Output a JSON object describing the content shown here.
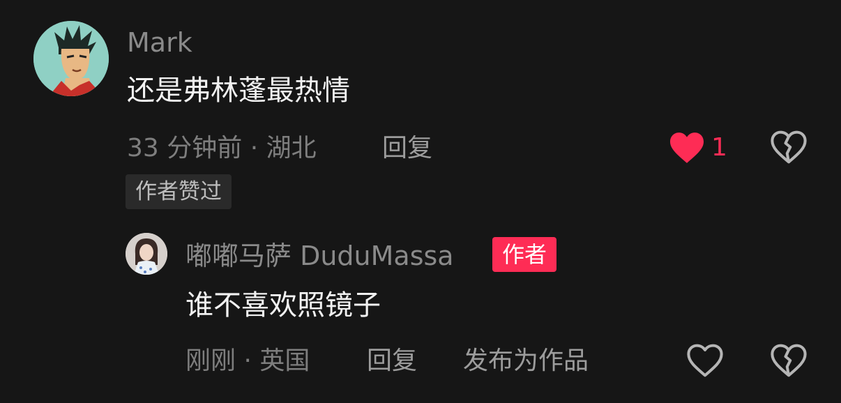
{
  "main_comment": {
    "username": "Mark",
    "text": "还是弗林蓬最热情",
    "meta": "33 分钟前 · 湖北",
    "reply_label": "回复",
    "badge": "作者赞过",
    "like_count": "1",
    "liked": true
  },
  "reply_comment": {
    "username": "嘟嘟马萨 DuduMassa",
    "author_tag": "作者",
    "text": "谁不喜欢照镜子",
    "meta": "刚刚 · 英国",
    "reply_label": "回复",
    "publish_label": "发布为作品",
    "liked": false
  },
  "colors": {
    "background": "#161616",
    "like_red": "#fe2c55",
    "author_tag_bg": "#fe2c55",
    "muted_text": "#7e7e7e"
  },
  "icons": {
    "like_filled": "heart-filled-icon",
    "like_outline": "heart-outline-icon",
    "dislike": "broken-heart-icon"
  }
}
